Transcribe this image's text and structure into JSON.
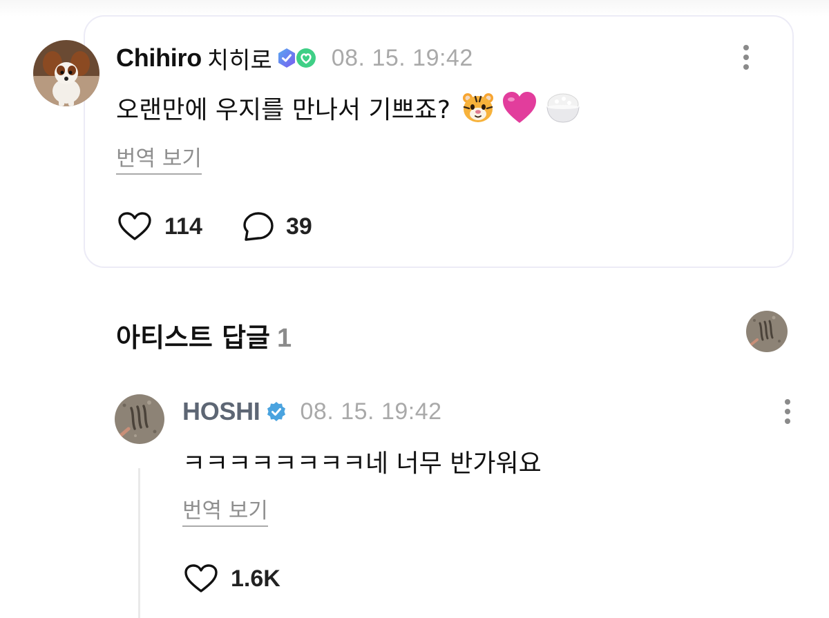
{
  "comment": {
    "author_name": "Chihiro",
    "author_subname": "치히로",
    "badges": [
      "hexagon-verified-badge",
      "green-heart-badge"
    ],
    "timestamp": "08. 15. 19:42",
    "text": "오랜만에 우지를 만나서 기쁘죠?",
    "emojis": [
      "tiger-face-emoji",
      "pink-heart-emoji",
      "rice-bowl-emoji"
    ],
    "translate_label": "번역 보기",
    "like_count": "114",
    "reply_count": "39"
  },
  "artist_section": {
    "title": "아티스트 답글",
    "count": "1"
  },
  "reply": {
    "author_name": "HOSHI",
    "badge": "blue-verified-badge",
    "timestamp": "08. 15. 19:42",
    "text": "ㅋㅋㅋㅋㅋㅋㅋㅋ네 너무 반가워요",
    "translate_label": "번역 보기",
    "like_count": "1.6K"
  },
  "colors": {
    "card_border": "#ecebf6",
    "timestamp": "#a9a9a9",
    "artist_name": "#5d6674",
    "verified_blue": "#4aa3df",
    "heart_pink": "#e23d9c"
  }
}
